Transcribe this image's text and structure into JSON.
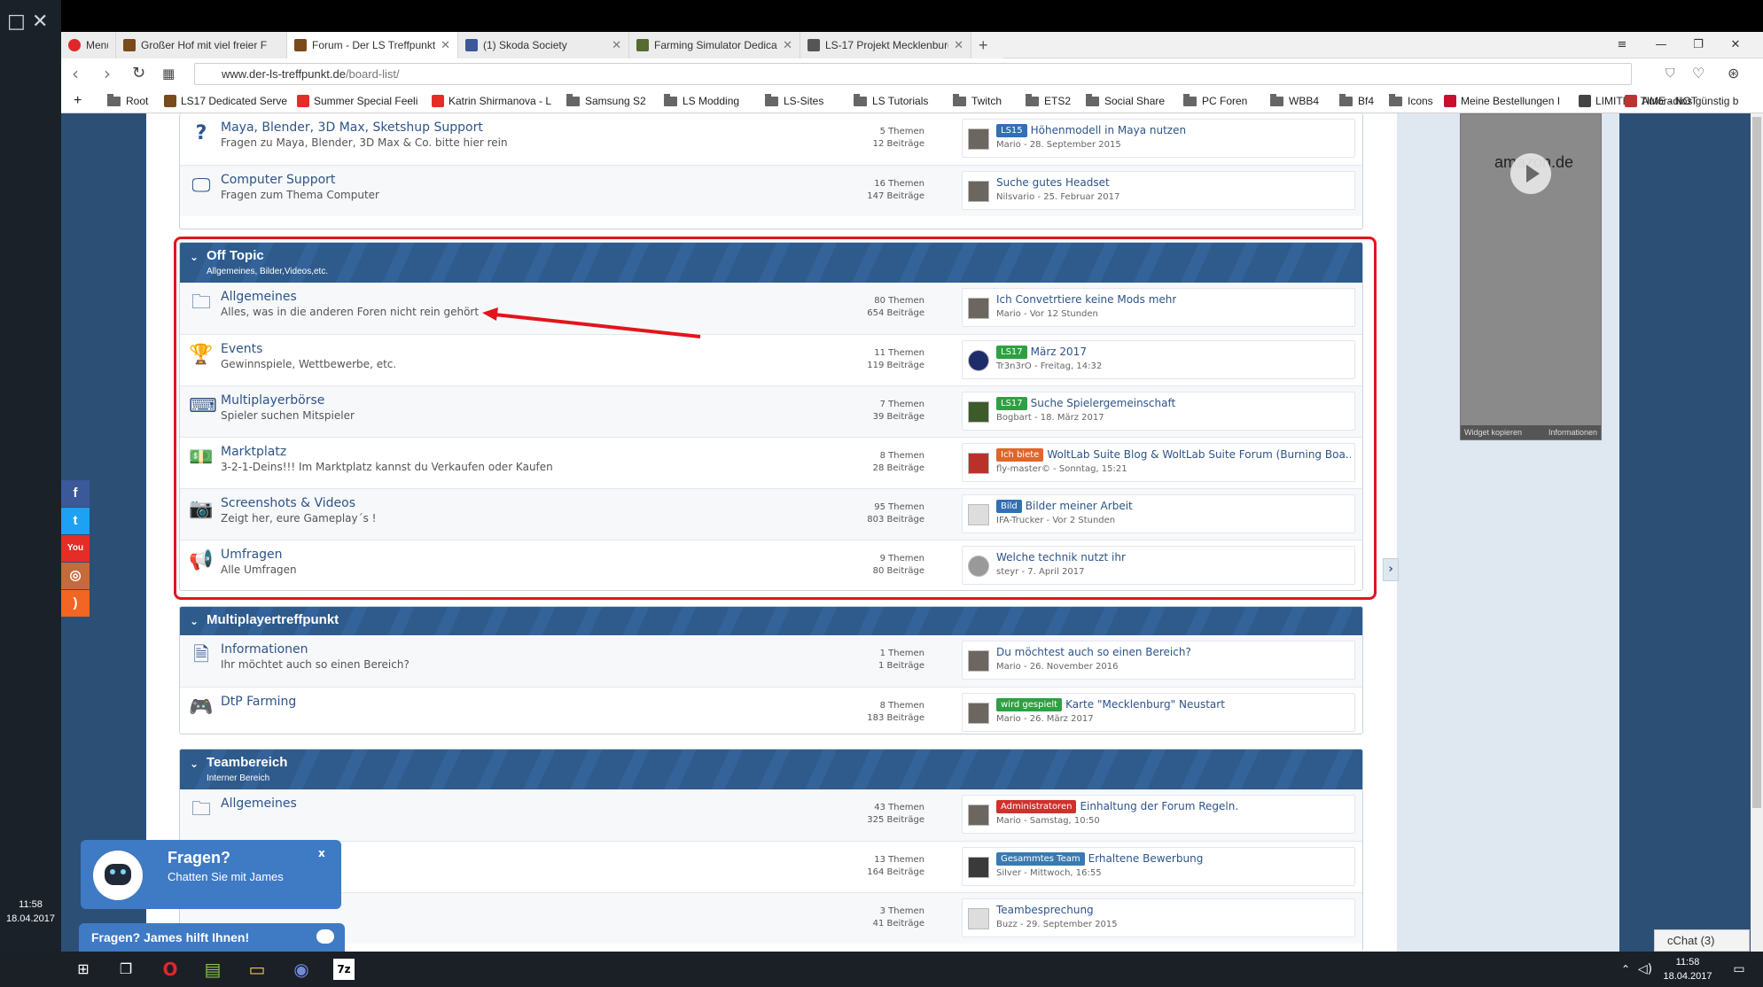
{
  "colors": {
    "accent": "#2e5b8c",
    "highlight": "#e2151b",
    "link": "#2d5488"
  },
  "left_clock": {
    "time": "11:58",
    "date": "18.04.2017"
  },
  "tabs": [
    {
      "label": "Menü",
      "icon": "opera-icon",
      "color": "#e0262b"
    },
    {
      "label": "Großer Hof mit viel freier F",
      "icon": "tractor-icon",
      "color": "#7a4a1a"
    },
    {
      "label": "Forum - Der LS Treffpunkt",
      "icon": "tractor-icon",
      "color": "#7a4a1a"
    },
    {
      "label": "(1) Skoda Society",
      "icon": "facebook-icon",
      "color": "#3b5998"
    },
    {
      "label": "Farming Simulator Dedicat",
      "icon": "game-icon",
      "color": "#556b2f"
    },
    {
      "label": "LS-17 Projekt Mecklenburg",
      "icon": "page-icon",
      "color": "#555555"
    }
  ],
  "url": {
    "host": "www.der-ls-treffpunkt.de",
    "path": "/board-list/"
  },
  "bookmarks": [
    {
      "label": "Root",
      "type": "folder"
    },
    {
      "label": "LS17 Dedicated Serve",
      "type": "site",
      "color": "#7a4a1a"
    },
    {
      "label": "Summer Special Feeli",
      "type": "site",
      "color": "#e52d27"
    },
    {
      "label": "Katrin Shirmanova - L",
      "type": "site",
      "color": "#e52d27"
    },
    {
      "label": "Samsung S2",
      "type": "folder"
    },
    {
      "label": "LS Modding",
      "type": "folder"
    },
    {
      "label": "LS-Sites",
      "type": "folder"
    },
    {
      "label": "LS Tutorials",
      "type": "folder"
    },
    {
      "label": "Twitch",
      "type": "folder"
    },
    {
      "label": "ETS2",
      "type": "folder"
    },
    {
      "label": "Social Share",
      "type": "folder"
    },
    {
      "label": "PC Foren",
      "type": "folder"
    },
    {
      "label": "WBB4",
      "type": "folder"
    },
    {
      "label": "Bf4",
      "type": "folder"
    },
    {
      "label": "Icons",
      "type": "folder"
    },
    {
      "label": "Meine Bestellungen I",
      "type": "site",
      "color": "#c8102e"
    },
    {
      "label": "LIMITED TIME - NOT",
      "type": "site",
      "color": "#444444"
    },
    {
      "label": "Autoradios günstig b",
      "type": "site",
      "color": "#b33"
    }
  ],
  "sections": [
    {
      "id": "top",
      "title": "",
      "subtitle": "",
      "boards": [
        {
          "name": "Maya, Blender, 3D Max, Sketshup Support",
          "desc": "Fragen zu Maya, Blender, 3D Max & Co. bitte hier rein",
          "icon": "question-icon",
          "themen": "5 Themen",
          "beitraege": "12 Beiträge",
          "badge": "LS15",
          "badge_color": "b-blue",
          "last_title": "Höhenmodell in Maya nutzen",
          "last_meta": "Mario - 28. September 2015"
        },
        {
          "name": "Computer Support",
          "desc": "Fragen zum Thema Computer",
          "icon": "monitor-icon",
          "themen": "16 Themen",
          "beitraege": "147 Beiträge",
          "badge": "",
          "badge_color": "",
          "last_title": "Suche gutes Headset",
          "last_meta": "Nilsvario - 25. Februar 2017"
        }
      ]
    },
    {
      "id": "offtopic",
      "title": "Off Topic",
      "subtitle": "Allgemeines, Bilder,Videos,etc.",
      "boards": [
        {
          "name": "Allgemeines",
          "desc": "Alles, was in die anderen Foren nicht rein gehört",
          "icon": "folder-icon",
          "themen": "80 Themen",
          "beitraege": "654 Beiträge",
          "badge": "",
          "badge_color": "",
          "last_title": "Ich Convetrtiere keine Mods mehr",
          "last_meta": "Mario - Vor 12 Stunden"
        },
        {
          "name": "Events",
          "desc": "Gewinnspiele, Wettbewerbe, etc.",
          "icon": "trophy-icon",
          "themen": "11 Themen",
          "beitraege": "119 Beiträge",
          "badge": "LS17",
          "badge_color": "b-green",
          "last_title": "März 2017",
          "last_meta": "Tr3n3rO - Freitag, 14:32"
        },
        {
          "name": "Multiplayerbörse",
          "desc": "Spieler suchen Mitspieler",
          "icon": "keyboard-icon",
          "themen": "7 Themen",
          "beitraege": "39 Beiträge",
          "badge": "LS17",
          "badge_color": "b-green",
          "last_title": "Suche Spielergemeinschaft",
          "last_meta": "Bogbart - 18. März 2017"
        },
        {
          "name": "Marktplatz",
          "desc": "3-2-1-Deins!!! Im Marktplatz kannst du Verkaufen oder Kaufen",
          "icon": "money-icon",
          "themen": "8 Themen",
          "beitraege": "28 Beiträge",
          "badge": "Ich biete",
          "badge_color": "b-orange",
          "last_title": "WoltLab Suite Blog & WoltLab Suite Forum (Burning Boa…",
          "last_meta": "fly-master© - Sonntag, 15:21"
        },
        {
          "name": "Screenshots & Videos",
          "desc": "Zeigt her, eure Gameplay´s !",
          "icon": "camera-icon",
          "themen": "95 Themen",
          "beitraege": "803 Beiträge",
          "badge": "Bild",
          "badge_color": "b-blue",
          "last_title": "Bilder meiner Arbeit",
          "last_meta": "IFA-Trucker - Vor 2 Stunden"
        },
        {
          "name": "Umfragen",
          "desc": "Alle Umfragen",
          "icon": "megaphone-icon",
          "themen": "9 Themen",
          "beitraege": "80 Beiträge",
          "badge": "",
          "badge_color": "",
          "last_title": "Welche technik nutzt ihr",
          "last_meta": "steyr - 7. April 2017"
        }
      ]
    },
    {
      "id": "mp",
      "title": "Multiplayertreffpunkt",
      "subtitle": "",
      "boards": [
        {
          "name": "Informationen",
          "desc": "Ihr möchtet auch so einen Bereich?",
          "icon": "document-icon",
          "themen": "1 Themen",
          "beitraege": "1 Beiträge",
          "badge": "",
          "badge_color": "",
          "last_title": "Du möchtest auch so einen Bereich?",
          "last_meta": "Mario - 26. November 2016"
        },
        {
          "name": "DtP Farming",
          "desc": "",
          "icon": "gamepad-icon",
          "themen": "8 Themen",
          "beitraege": "183 Beiträge",
          "badge": "wird gespielt",
          "badge_color": "b-green",
          "last_title": "Karte \"Mecklenburg\" Neustart",
          "last_meta": "Mario - 26. März 2017"
        }
      ]
    },
    {
      "id": "team",
      "title": "Teambereich",
      "subtitle": "Interner Bereich",
      "boards": [
        {
          "name": "Allgemeines",
          "desc": "",
          "icon": "folder-icon",
          "themen": "43 Themen",
          "beitraege": "325 Beiträge",
          "badge": "Administratoren",
          "badge_color": "b-red",
          "last_title": "Einhaltung der Forum Regeln.",
          "last_meta": "Mario - Samstag, 10:50"
        },
        {
          "name": "",
          "desc": "",
          "icon": "",
          "themen": "13 Themen",
          "beitraege": "164 Beiträge",
          "badge": "Gesammtes Team",
          "badge_color": "b-teal",
          "last_title": "Erhaltene Bewerbung",
          "last_meta": "Silver - Mittwoch, 16:55"
        },
        {
          "name": "",
          "desc": "",
          "icon": "",
          "themen": "3 Themen",
          "beitraege": "41 Beiträge",
          "badge": "",
          "badge_color": "",
          "last_title": "Teambesprechung",
          "last_meta": "Buzz - 29. September 2015"
        }
      ]
    }
  ],
  "social": [
    {
      "icon": "facebook-icon",
      "glyph": "f",
      "color": "#3b5998"
    },
    {
      "icon": "twitter-icon",
      "glyph": "t",
      "color": "#1da1f2"
    },
    {
      "icon": "youtube-icon",
      "glyph": "You",
      "color": "#e52d27"
    },
    {
      "icon": "instagram-icon",
      "glyph": "◎",
      "color": "#c56a3a"
    },
    {
      "icon": "rss-icon",
      "glyph": ")",
      "color": "#f26522"
    }
  ],
  "amazon": {
    "logo": "amazon.de",
    "footer": "Widget kopieren",
    "info": "Informationen"
  },
  "chat": {
    "title": "Fragen?",
    "subtitle": "Chatten Sie mit James",
    "close": "x",
    "bar": "Fragen? James hilft Ihnen!"
  },
  "cchat": "cChat (3)",
  "taskbar": {
    "time": "11:58",
    "date": "18.04.2017"
  }
}
